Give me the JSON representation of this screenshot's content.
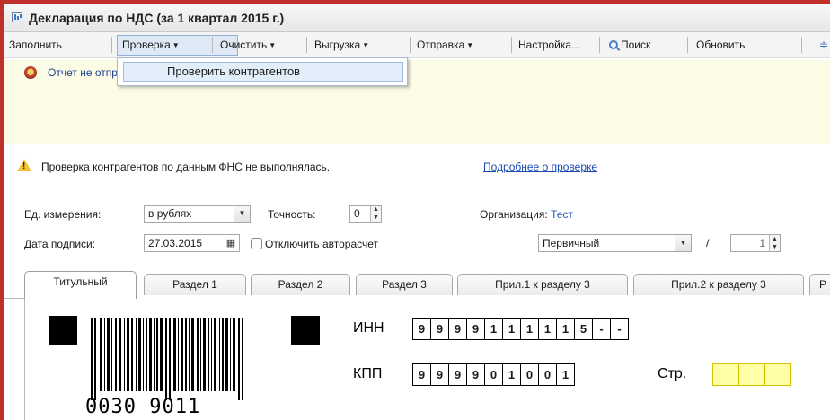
{
  "window": {
    "title": "Декларация по НДС (за 1 квартал 2015 г.)"
  },
  "toolbar": {
    "fill": "Заполнить",
    "check": "Проверка",
    "clear": "Очистить",
    "export": "Выгрузка",
    "send": "Отправка",
    "settings": "Настройка...",
    "search": "Поиск",
    "refresh": "Обновить"
  },
  "dropdown_menu": {
    "check_counterparties": "Проверить контрагентов"
  },
  "info": {
    "not_sent": "Отчет не отправлялся."
  },
  "warning": {
    "text": "Проверка контрагентов по данным ФНС не выполнялась.",
    "link": "Подробнее о проверке"
  },
  "form": {
    "unit_label": "Ед. измерения:",
    "unit_value": "в рублях",
    "precision_label": "Точность:",
    "precision_value": "0",
    "org_label": "Организация:",
    "org_value": "Тест",
    "sign_date_label": "Дата подписи:",
    "sign_date_value": "27.03.2015",
    "disable_autocalc_label": "Отключить авторасчет",
    "report_kind": "Первичный",
    "slash": "/",
    "correction_number": "1"
  },
  "tabs": [
    "Титульный",
    "Раздел 1",
    "Раздел 2",
    "Раздел 3",
    "Прил.1 к разделу 3",
    "Прил.2 к разделу 3",
    "Р"
  ],
  "title_page": {
    "barcode_number": "0030 9011",
    "inn_label": "ИНН",
    "inn_digits": [
      "9",
      "9",
      "9",
      "9",
      "1",
      "1",
      "1",
      "1",
      "1",
      "5",
      "-",
      "-"
    ],
    "kpp_label": "КПП",
    "kpp_digits": [
      "9",
      "9",
      "9",
      "9",
      "0",
      "1",
      "0",
      "0",
      "1"
    ],
    "page_label": "Стр."
  },
  "colors": {
    "accent_frame": "#c0302b",
    "infobar_bg": "#fbfbe6",
    "link": "#1c49b8",
    "page_cells": "#ffffa8"
  }
}
